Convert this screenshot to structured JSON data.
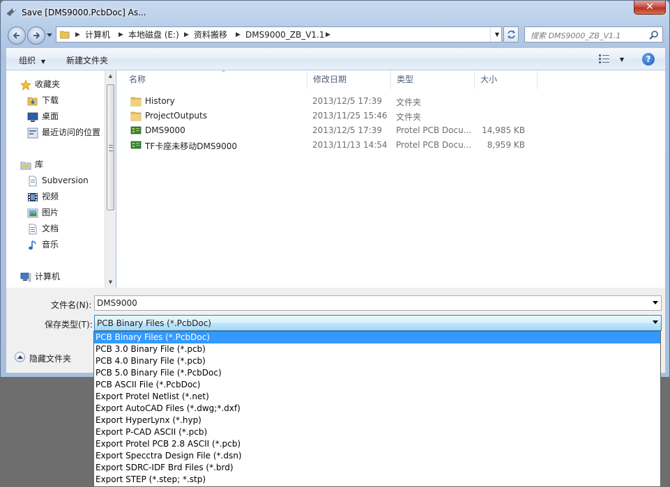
{
  "window": {
    "title": "Save [DMS9000.PcbDoc] As..."
  },
  "address": {
    "crumbs": [
      "计算机",
      "本地磁盘 (E:)",
      "资料搬移",
      "DMS9000_ZB_V1.1"
    ]
  },
  "search": {
    "placeholder": "搜索 DMS9000_ZB_V1.1"
  },
  "toolbar": {
    "organize": "组织",
    "new_folder": "新建文件夹"
  },
  "nav": {
    "favorites": "收藏夹",
    "downloads": "下载",
    "desktop": "桌面",
    "recent": "最近访问的位置",
    "libraries": "库",
    "subversion": "Subversion",
    "videos": "视频",
    "pictures": "图片",
    "documents": "文档",
    "music": "音乐",
    "computer": "计算机"
  },
  "columns": {
    "name": "名称",
    "date": "修改日期",
    "type": "类型",
    "size": "大小"
  },
  "files": [
    {
      "name": "History",
      "date": "2013/12/5 17:39",
      "type": "文件夹",
      "size": "",
      "icon": "folder-icon"
    },
    {
      "name": "ProjectOutputs",
      "date": "2013/11/25 15:46",
      "type": "文件夹",
      "size": "",
      "icon": "folder-icon"
    },
    {
      "name": "DMS9000",
      "date": "2013/12/5 17:39",
      "type": "Protel PCB Docu...",
      "size": "14,985 KB",
      "icon": "pcb-doc-icon"
    },
    {
      "name": "TF卡座未移动DMS9000",
      "date": "2013/11/13 14:54",
      "type": "Protel PCB Docu...",
      "size": "8,959 KB",
      "icon": "pcb-doc-icon"
    }
  ],
  "form": {
    "filename_label": "文件名(N):",
    "filename_value": "DMS9000",
    "filetype_label": "保存类型(T):",
    "filetype_value": "PCB Binary Files (*.PcbDoc)",
    "hide_folders": "隐藏文件夹"
  },
  "filetype_options": [
    "PCB Binary Files (*.PcbDoc)",
    "PCB 3.0 Binary File (*.pcb)",
    "PCB 4.0 Binary File (*.pcb)",
    "PCB 5.0 Binary File (*.PcbDoc)",
    "PCB ASCII File (*.PcbDoc)",
    "Export Protel Netlist (*.net)",
    "Export AutoCAD Files (*.dwg;*.dxf)",
    "Export HyperLynx (*.hyp)",
    "Export P-CAD ASCII (*.pcb)",
    "Export Protel PCB 2.8 ASCII (*.pcb)",
    "Export Specctra Design File (*.dsn)",
    "Export SDRC-IDF Brd Files (*.brd)",
    "Export STEP (*.step; *.stp)"
  ],
  "colors": {
    "selection": "#3399ff",
    "folder": "#e8c25a",
    "pcb_icon": "#2f8a3a",
    "close_button": "#c75050"
  }
}
